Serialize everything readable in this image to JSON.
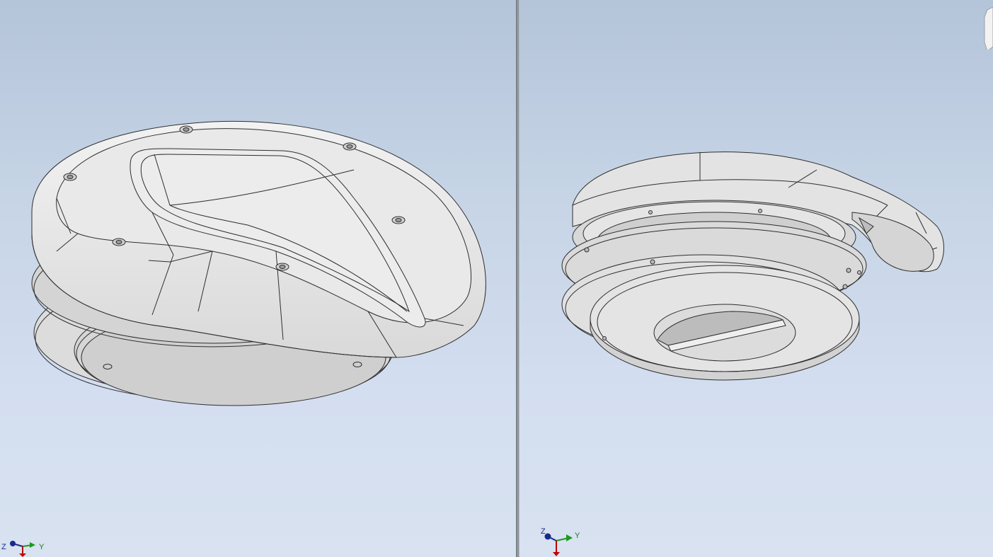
{
  "viewports": [
    {
      "name": "view-left",
      "model": "vent-cap-top-view",
      "triad": {
        "z_label": "Z",
        "y_label": "Y"
      }
    },
    {
      "name": "view-right",
      "model": "vent-cap-bottom-view",
      "triad": {
        "z_label": "Z",
        "y_label": "Y"
      }
    }
  ],
  "colors": {
    "background_top": "#b4c4d9",
    "background_bottom": "#d8e2f0",
    "model_face": "#e6e6e6",
    "model_edge": "#2e2e2e",
    "axis_z": "#1a2a8a",
    "axis_y": "#1c9a1c",
    "axis_x": "#c00000",
    "splitter": "#8f959c"
  },
  "icons": [
    "triad-axis-icon",
    "viewcube-icon"
  ]
}
